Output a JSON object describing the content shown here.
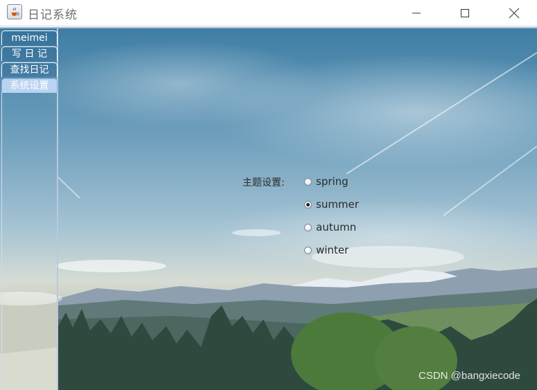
{
  "window": {
    "title": "日记系统",
    "icon": "java-cup-icon",
    "controls": [
      "minimize-icon",
      "maximize-icon",
      "close-icon"
    ]
  },
  "tabs": [
    {
      "label": "meimei",
      "selected": false
    },
    {
      "label": "写 日 记",
      "selected": false
    },
    {
      "label": "查找日记",
      "selected": false
    },
    {
      "label": "系统设置",
      "selected": true
    }
  ],
  "settings": {
    "theme_label": "主题设置:",
    "options": [
      {
        "label": "spring",
        "checked": false
      },
      {
        "label": "summer",
        "checked": true
      },
      {
        "label": "autumn",
        "checked": false
      },
      {
        "label": "winter",
        "checked": false
      }
    ]
  },
  "watermark": "CSDN @bangxiecode",
  "colors": {
    "selected_tab": "#b9d3f1",
    "frame_accent": "#a9bdd8"
  }
}
